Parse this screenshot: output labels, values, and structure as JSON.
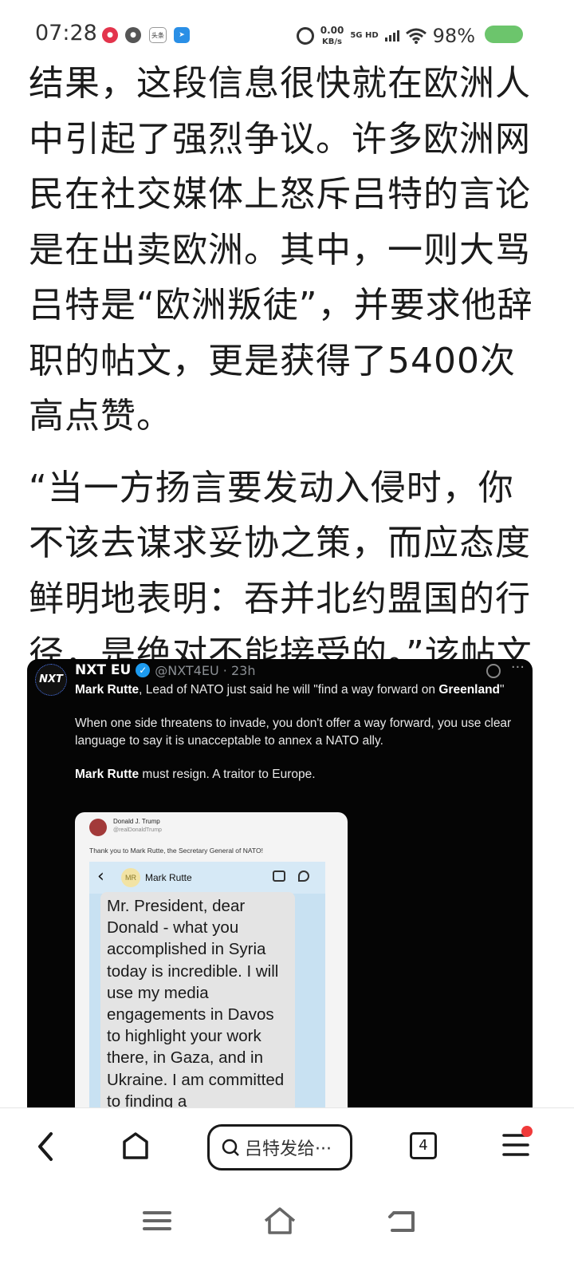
{
  "status_bar": {
    "time": "07:28",
    "speed_top": "0.00",
    "speed_unit": "KB/s",
    "network": "5G HD",
    "battery": "98%",
    "app_icon_news": "头条"
  },
  "article": {
    "paragraph1": "结果，这段信息很快就在欧洲人中引起了强烈争议。许多欧洲网民在社交媒体上怒斥吕特的言论是在出卖欧洲。其中，一则大骂吕特是“欧洲叛徒”，并要求他辞职的帖文，更是获得了5400次高点赞。",
    "paragraph2": "“当一方扬言要发动入侵时，你不该去谋求妥协之策，而应态度鲜明地表明：吞并北约盟国的行径，是绝对不能接受的。”该帖文写道。"
  },
  "tweet": {
    "avatar_text": "NXT",
    "name": "NXT EU",
    "handle": "@NXT4EU · 23h",
    "line1_bold": "Mark Rutte",
    "line1_rest": ", Lead of NATO just said he will \"find a way forward on ",
    "line1_bold2": "Greenland",
    "line1_end": "\"",
    "line2": "When one side threatens to invade, you don't offer a way forward, you use clear language to say it is unacceptable to annex a NATO ally.",
    "line3_bold": "Mark Rutte",
    "line3_rest": " must resign. A traitor to Europe.",
    "inner": {
      "name": "Donald J. Trump",
      "handle": "@realDonaldTrump",
      "thanks": "Thank you to Mark Rutte, the Secretary General of NATO!",
      "chat_initials": "MR",
      "chat_name": "Mark Rutte",
      "message": "Mr. President, dear Donald - what you accomplished in Syria today is incredible. I will use my media engagements in Davos to highlight your work there, in Gaza, and in Ukraine. I am committed to finding a"
    }
  },
  "bottom_nav": {
    "search_text": "吕特发给···",
    "tabs_count": "4"
  },
  "colors": {
    "accent_red": "#f03a3a",
    "battery_green": "#6cc56c",
    "verified_blue": "#1d9bf0"
  }
}
